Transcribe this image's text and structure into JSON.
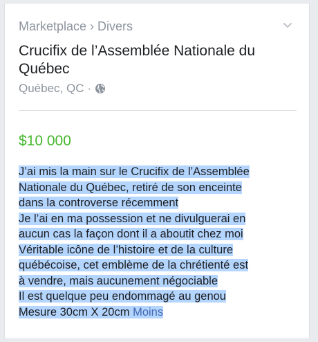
{
  "breadcrumb": {
    "items": [
      "Marketplace",
      "Divers"
    ],
    "separator": "›"
  },
  "listing": {
    "title": "Crucifix de l’Assemblée Nationale du Québec",
    "location": "Québec, QC",
    "location_separator": "·",
    "privacy_icon": "globe-icon",
    "price": "$10 000",
    "description_lines": [
      "J’ai mis la main sur le Crucifix de l’Assemblée",
      "Nationale du Québec, retiré de son enceinte",
      "dans la controverse récemment",
      "Je l’ai en ma possession et ne divulguerai en",
      "aucun cas la façon dont il a aboutit chez moi",
      "Véritable icône de l’histoire et de la culture",
      "québécoise, cet emblème de la chrétienté est",
      "à vendre, mais aucunement négociable",
      "Il est quelque peu endommagé au genou",
      "Mesure 30cm X 20cm"
    ],
    "see_less": "Moins"
  },
  "colors": {
    "price": "#42b72a",
    "link": "#4267b2",
    "selection": "#b4d5fe",
    "muted": "#8d949e"
  }
}
